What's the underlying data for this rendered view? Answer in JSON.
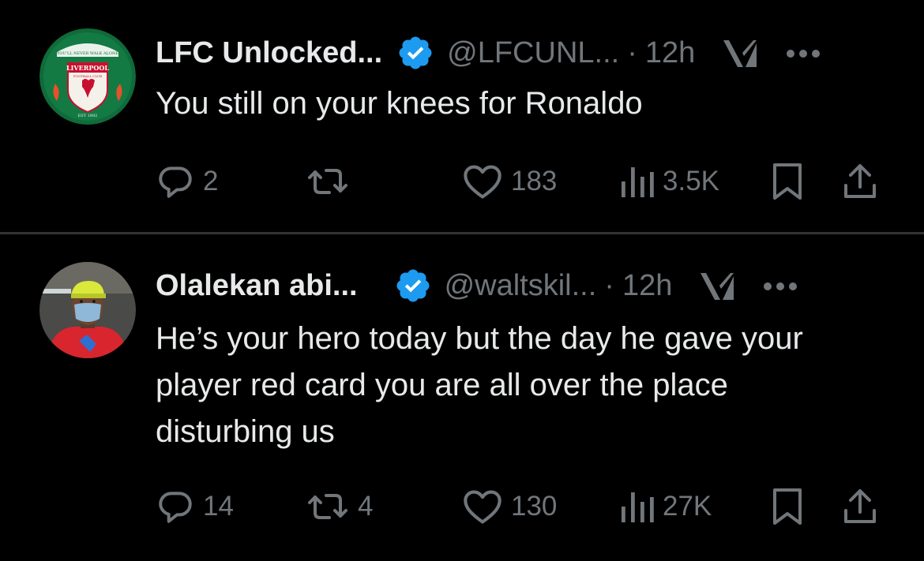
{
  "colors": {
    "background": "#000000",
    "text_primary": "#e7e9ea",
    "text_secondary": "#71767b",
    "verified_blue": "#1d9bf0",
    "divider": "#2f3336"
  },
  "tweets": [
    {
      "display_name": "LFC Unlocked...",
      "handle": "@LFCUNL...",
      "separator": "·",
      "time": "12h",
      "avatar_icon": "liverpool-fc-crest",
      "avatar_text": {
        "banner": "YOU'LL NEVER WALK ALONE",
        "club": "LIVERPOOL",
        "sub": "FOOTBALL CLUB",
        "est": "EST 1892"
      },
      "text": "You still on your knees for Ronaldo",
      "replies": "2",
      "retweets": "",
      "likes": "183",
      "views": "3.5K"
    },
    {
      "display_name": "Olalekan abi...",
      "handle": "@waltskil...",
      "separator": "·",
      "time": "12h",
      "avatar_icon": "user-photo-masked-person",
      "text": "He’s your hero today but the day he gave your player red card you are all over the place disturbing us",
      "replies": "14",
      "retweets": "4",
      "likes": "130",
      "views": "27K"
    }
  ]
}
